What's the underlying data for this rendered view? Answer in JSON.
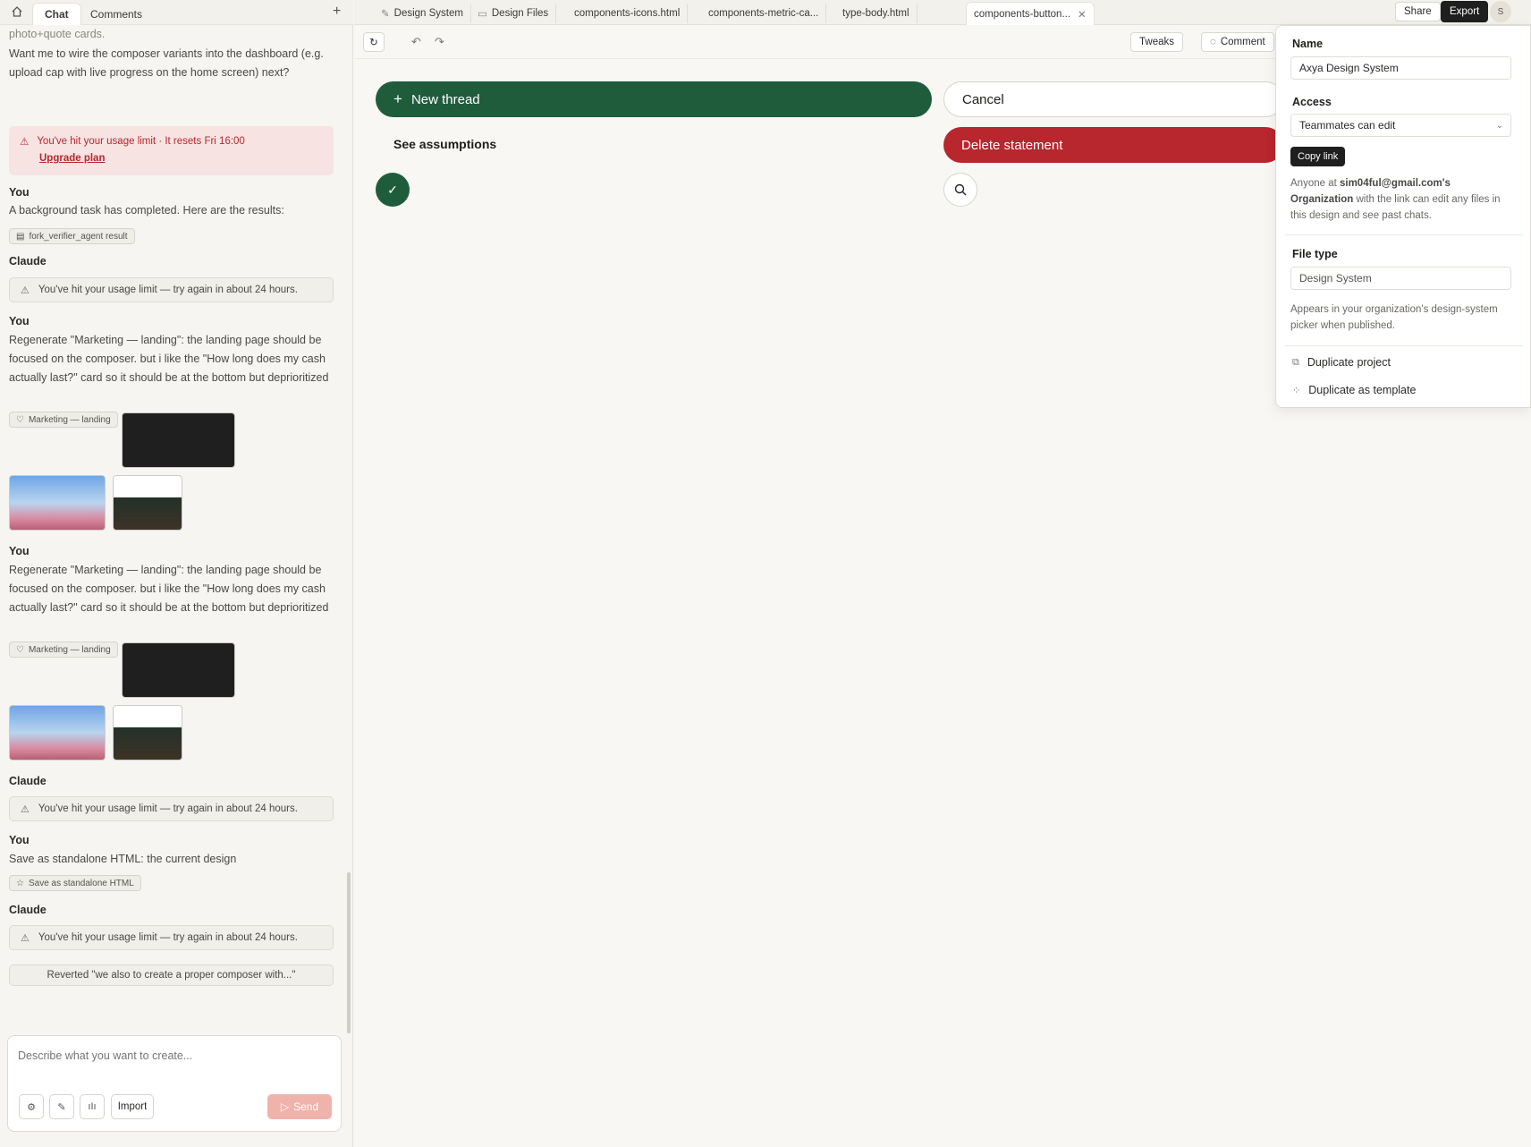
{
  "left_tabs": {
    "chat": "Chat",
    "comments": "Comments",
    "plus": "+"
  },
  "chat": {
    "truncated_top": "photo+quote cards.",
    "msg1": "Want me to wire the composer variants into the dashboard (e.g. upload cap with live progress on the home screen) next?",
    "upgrade_notice": "You've hit your usage limit · It resets Fri 16:00",
    "upgrade_link": "Upgrade plan",
    "you": "You",
    "claude": "Claude",
    "bg_task": "A background task has completed. Here are the results:",
    "chip_fork": "fork_verifier_agent result",
    "limit_24h": "You've hit your usage limit — try again in about 24 hours.",
    "regenerate": "Regenerate \"Marketing — landing\": the landing page should be focused on the composer. but i like the \"How long does my cash actually last?\" card so it should be at the bottom but deprioritized",
    "chip_marketing": "Marketing — landing",
    "save_html": "Save as standalone HTML: the current design",
    "chip_save": "Save as standalone HTML",
    "reverted": "Reverted \"we also to create a proper composer with...\""
  },
  "composer": {
    "placeholder": "Describe what you want to create...",
    "import": "Import",
    "send": "Send"
  },
  "tabs": [
    {
      "label": "Design System"
    },
    {
      "label": "Design Files"
    },
    {
      "label": "components-icons.html"
    },
    {
      "label": "components-metric-ca..."
    },
    {
      "label": "type-body.html"
    },
    {
      "label": "components-button..."
    }
  ],
  "top_actions": {
    "share": "Share",
    "export": "Export",
    "avatar": "S"
  },
  "toolbar": {
    "tweaks": "Tweaks",
    "comment": "Comment"
  },
  "canvas": {
    "new_thread": "New thread",
    "cancel": "Cancel",
    "see_assumptions": "See assumptions",
    "delete_statement": "Delete statement"
  },
  "popover": {
    "name_label": "Name",
    "name_value": "Axya Design System",
    "access_label": "Access",
    "access_value": "Teammates can edit",
    "copy_link": "Copy link",
    "access_note_pre": "Anyone at ",
    "access_note_org": "sim04ful@gmail.com's Organization",
    "access_note_post": " with the link can edit any files in this design and see past chats.",
    "file_type_label": "File type",
    "file_type_value": "Design System",
    "file_type_note": "Appears in your organization's design-system picker when published.",
    "duplicate_project": "Duplicate project",
    "duplicate_template": "Duplicate as template"
  },
  "colors": {
    "green": "#1e5c3c",
    "red": "#b8262e",
    "dark": "#1f1f1f"
  }
}
